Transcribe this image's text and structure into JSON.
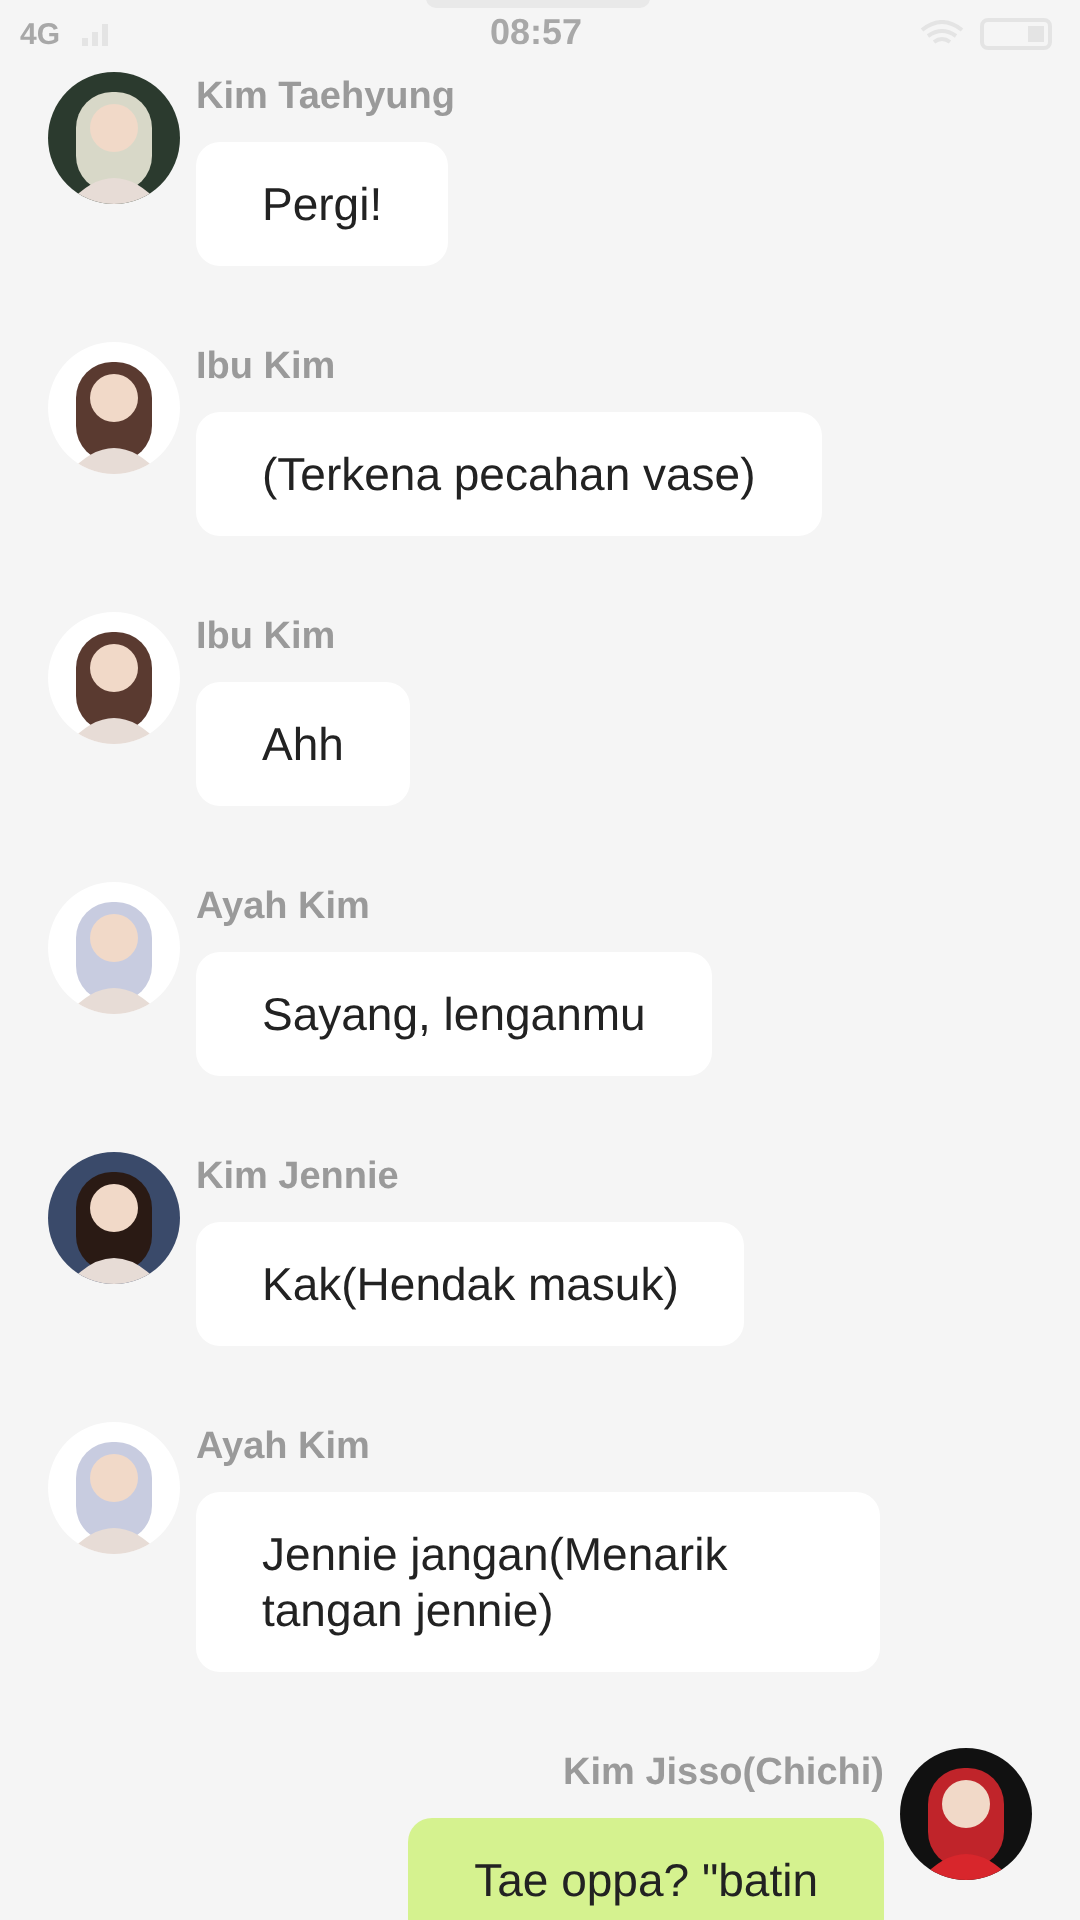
{
  "status_bar": {
    "carrier": "4G",
    "time": "08:57"
  },
  "messages": [
    {
      "sender": "Kim Taehyung",
      "text": "Pergi!",
      "outgoing": false
    },
    {
      "sender": "Ibu Kim",
      "text": "(Terkena pecahan vase)",
      "outgoing": false
    },
    {
      "sender": "Ibu Kim",
      "text": "Ahh",
      "outgoing": false
    },
    {
      "sender": "Ayah Kim",
      "text": "Sayang, lenganmu",
      "outgoing": false
    },
    {
      "sender": "Kim Jennie",
      "text": "Kak(Hendak masuk)",
      "outgoing": false
    },
    {
      "sender": "Ayah Kim",
      "text": "Jennie jangan(Menarik tangan jennie)",
      "outgoing": false
    },
    {
      "sender": "Kim Jisso(Chichi)",
      "text": "Tae oppa? \"batin",
      "outgoing": true
    }
  ]
}
